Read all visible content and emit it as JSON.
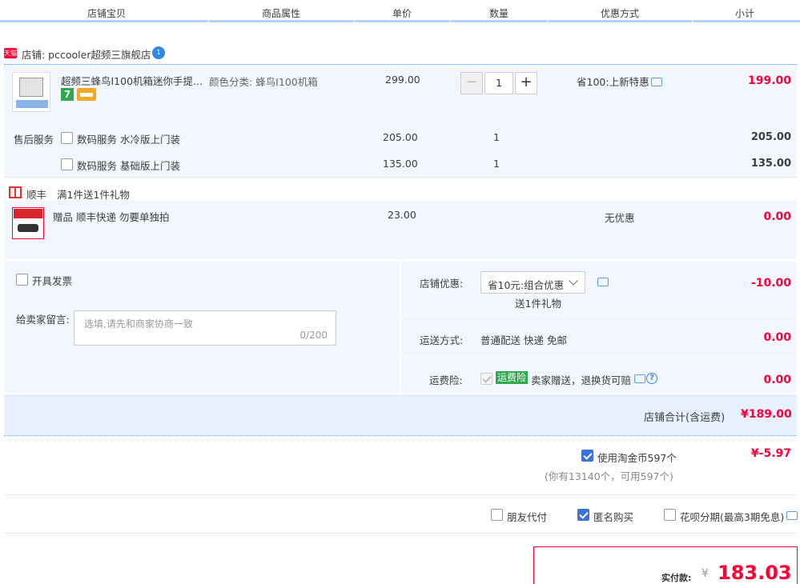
{
  "header": {
    "columns": [
      "店铺宝贝",
      "商品属性",
      "单价",
      "数量",
      "优惠方式",
      "小计"
    ]
  },
  "shop": {
    "badge": "天猫",
    "name": "店铺: pccooler超频三旗舰店",
    "ww": "1"
  },
  "item": {
    "title": "超频三蜂鸟I100机箱迷你手提...",
    "badge7": "7",
    "attr": "颜色分类: 蜂鸟I100机箱",
    "price": "299.00",
    "qty": "1",
    "minus": "−",
    "plus": "+",
    "promo": "省100:上新特惠",
    "subtotal": "199.00"
  },
  "services": {
    "label": "售后服务",
    "items": [
      {
        "name": "数码服务 水冷版上门装",
        "price": "205.00",
        "qty": "1",
        "subtotal": "205.00"
      },
      {
        "name": "数码服务 基础版上门装",
        "price": "135.00",
        "qty": "1",
        "subtotal": "135.00"
      }
    ]
  },
  "gift_row": {
    "brand": "顺丰",
    "text": "满1件送1件礼物",
    "item_name": "赠品 顺丰快递 勿要单独拍",
    "price": "23.00",
    "promo": "无优惠",
    "subtotal": "0.00"
  },
  "panel": {
    "invoice": "开具发票",
    "message_label": "给卖家留言:",
    "message_placeholder": "选填,请先和商家协商一致",
    "message_count": "0/200",
    "shop_discount_label": "店铺优惠:",
    "shop_discount_value": "省10元:组合优惠",
    "gift_note": "送1件礼物",
    "shop_discount_amount": "-10.00",
    "shipping_label": "运送方式:",
    "shipping_value": "普通配送 快递 免邮",
    "shipping_amount": "0.00",
    "insurance_label": "运费险:",
    "insurance_badge": "运费险",
    "insurance_text": "卖家赠送，退换货可赔",
    "insurance_help": "?",
    "insurance_amount": "0.00"
  },
  "total": {
    "label": "店铺合计(含运费)",
    "value": "¥189.00"
  },
  "coins": {
    "label": "使用淘金币597个",
    "value": "¥-5.97",
    "note": "(你有13140个，可用597个)"
  },
  "options": {
    "friend_pay": "朋友代付",
    "anonymous": "匿名购买",
    "huabei": "花呗分期(最高3期免息)"
  },
  "final": {
    "label": "实付款:",
    "currency": "¥",
    "value": "183.03"
  },
  "colors": {
    "accent": "#ff0036",
    "blue_line": "#b2d1ff",
    "panel_bg": "#f2f7ff",
    "checkbox_blue": "#3b71d8"
  }
}
